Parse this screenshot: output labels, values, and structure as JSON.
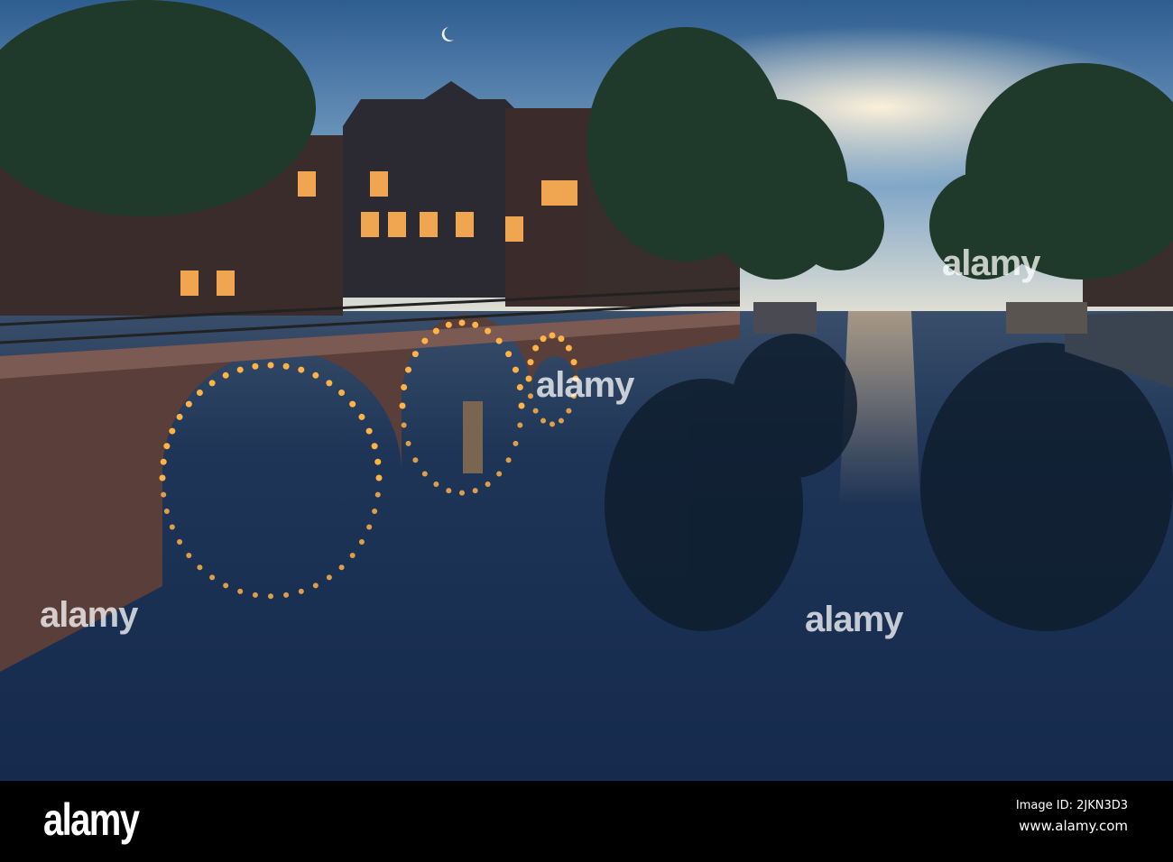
{
  "photo": {
    "subject": "Amsterdam canal at dusk with illuminated arched bridge",
    "colors": {
      "sky_top": "#2f5f93",
      "sky_glow": "#f3ead8",
      "water": "#16294a",
      "lights": "#ffb347"
    }
  },
  "watermark": {
    "text": "alamy"
  },
  "footer": {
    "logo": "alamy",
    "image_id": "Image ID: 2JKN3D3",
    "url": "www.alamy.com"
  }
}
